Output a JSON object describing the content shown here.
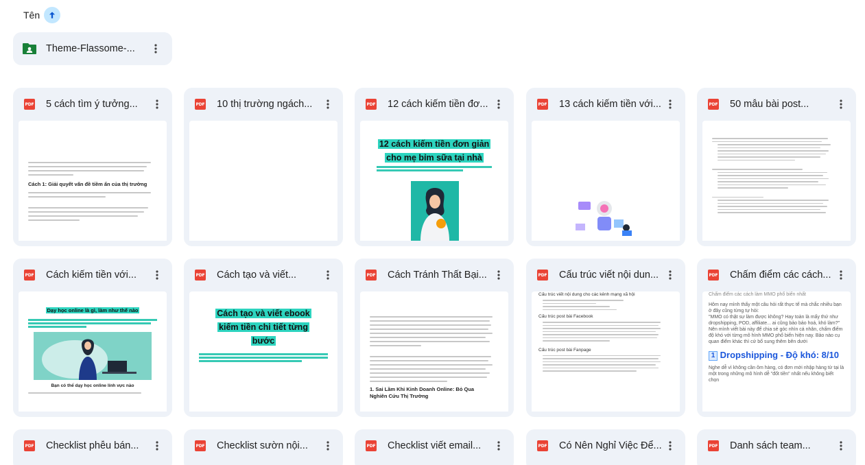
{
  "sort": {
    "label": "Tên",
    "direction_icon": "arrow-up-icon"
  },
  "folder": {
    "name": "Theme-Flassome-...",
    "icon": "shared-folder-icon",
    "color": "#188038"
  },
  "files": [
    {
      "name": "5 cách tìm ý tưởng...",
      "type": "PDF"
    },
    {
      "name": "10 thị trường ngách...",
      "type": "PDF"
    },
    {
      "name": "12 cách kiếm tiền đơ...",
      "type": "PDF"
    },
    {
      "name": "13 cách kiếm tiền với...",
      "type": "PDF"
    },
    {
      "name": "50 mẫu bài post...",
      "type": "PDF"
    },
    {
      "name": "Cách kiếm tiền với...",
      "type": "PDF"
    },
    {
      "name": "Cách tạo và viết...",
      "type": "PDF"
    },
    {
      "name": "Cách Tránh Thất Bại...",
      "type": "PDF"
    },
    {
      "name": "Cấu trúc viết nội dun...",
      "type": "PDF"
    },
    {
      "name": "Chấm điểm các cách...",
      "type": "PDF"
    },
    {
      "name": "Checklist phễu bán...",
      "type": "PDF"
    },
    {
      "name": "Checklist sườn nội...",
      "type": "PDF"
    },
    {
      "name": "Checklist viết email...",
      "type": "PDF"
    },
    {
      "name": "Có Nên Nghỉ Việc Để...",
      "type": "PDF"
    },
    {
      "name": "Danh sách team...",
      "type": "PDF"
    }
  ],
  "thumbs": {
    "t1": {
      "heading": "Cách 1: Giải quyết vấn đề tiềm ẩn của thị trường"
    },
    "t3": {
      "title_1": "12 cách kiếm tiền đơn giản",
      "title_2": "cho mẹ bỉm sữa tại nhà"
    },
    "t6": {
      "title": "Dạy học online là gì, làm như thế nào",
      "caption": "Bạn có thể dạy học online lính vực nào"
    },
    "t7": {
      "title_1": "Cách tạo và viết ebook",
      "title_2": "kiếm tiền chi tiết từng",
      "title_3": "bước"
    },
    "t8": {
      "heading_1": "1. Sai Lầm Khi Kinh Doanh Online: Bỏ Qua",
      "heading_2": "Nghiên Cứu Thị Trường"
    },
    "t9": {
      "title": "Cấu trúc viết nội dung cho các kênh mạng xã hội",
      "sub_1": "Cấu trúc post bài Facebook",
      "sub_2": "Cấu trúc post bài Fanpage"
    },
    "t10": {
      "top": "Chấm điểm các cách làm MMO phổ biến nhất",
      "p1": "Hôm nay mình thấy một câu hỏi rất thực tế mà chắc nhiều bạn ở đây cũng từng tự hỏi:",
      "p2": "\"MMO có thật sự làm được không? Hay toàn là mấy thứ như dropshipping, POD, affiliate... ai cũng bảo bảo hoá, khó làm?\"",
      "p3": "Nên mình viết bài này để chia sẻ góc nhìn cá nhân, chấm điểm độ khó với từng mô hình MMO phổ biến hiện nay. Bảo nào cụ quan điểm khác thì cứ bổ sung thêm bên dưới",
      "num": "1",
      "head": "Dropshipping - Độ khó: 8/10",
      "p4": "Nghe dễ vì không cần ôm hàng, có đơn mới nhập hàng từ tại là một trong những mô hình dễ \"đốt tiền\" nhất nếu không biết chọn"
    }
  },
  "colors": {
    "card_bg": "#eef2f8",
    "pdf_red": "#ea4335",
    "accent": "#c2e7ff",
    "highlight": "#2dd4bf"
  }
}
